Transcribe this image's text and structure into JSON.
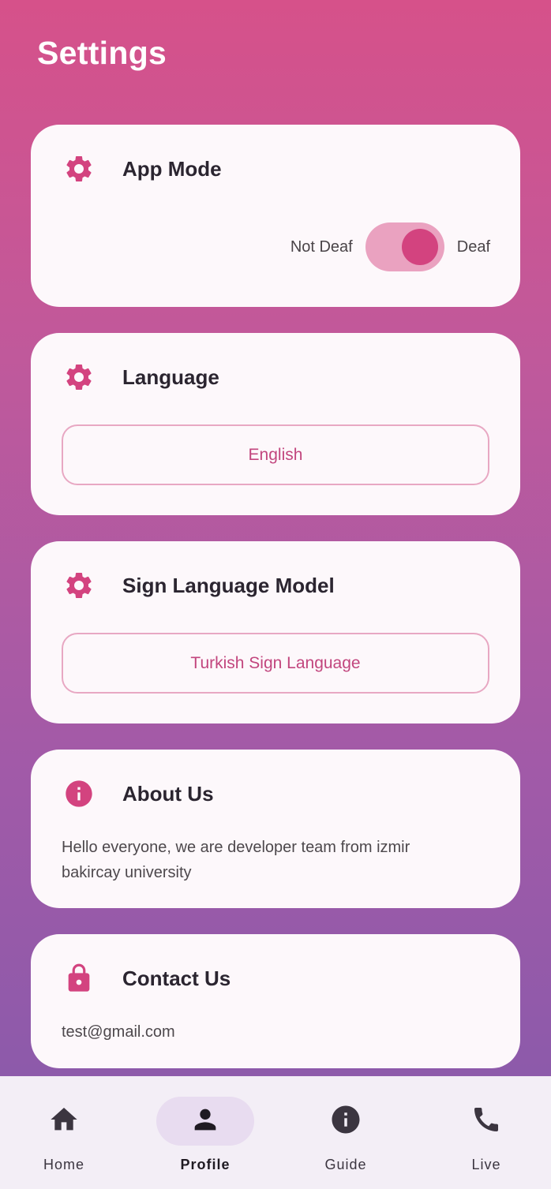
{
  "header": {
    "title": "Settings"
  },
  "colors": {
    "accent": "#d3437f",
    "nav_active_bg": "#e8dcf0",
    "card_bg": "#fdf8fb"
  },
  "app_mode": {
    "title": "App Mode",
    "icon": "gear-icon",
    "left_label": "Not Deaf",
    "right_label": "Deaf",
    "selected": "Deaf"
  },
  "language": {
    "title": "Language",
    "icon": "gear-icon",
    "value": "English"
  },
  "sign_model": {
    "title": "Sign Language Model",
    "icon": "gear-icon",
    "value": "Turkish Sign Language"
  },
  "about": {
    "title": "About Us",
    "icon": "info-icon",
    "text": "Hello everyone, we are developer team from izmir bakircay university"
  },
  "contact": {
    "title": "Contact Us",
    "icon": "lock-icon",
    "email": "test@gmail.com"
  },
  "nav": {
    "items": [
      {
        "label": "Home",
        "icon": "home-icon",
        "active": false
      },
      {
        "label": "Profile",
        "icon": "person-icon",
        "active": true
      },
      {
        "label": "Guide",
        "icon": "info-icon",
        "active": false
      },
      {
        "label": "Live",
        "icon": "phone-icon",
        "active": false
      }
    ]
  }
}
